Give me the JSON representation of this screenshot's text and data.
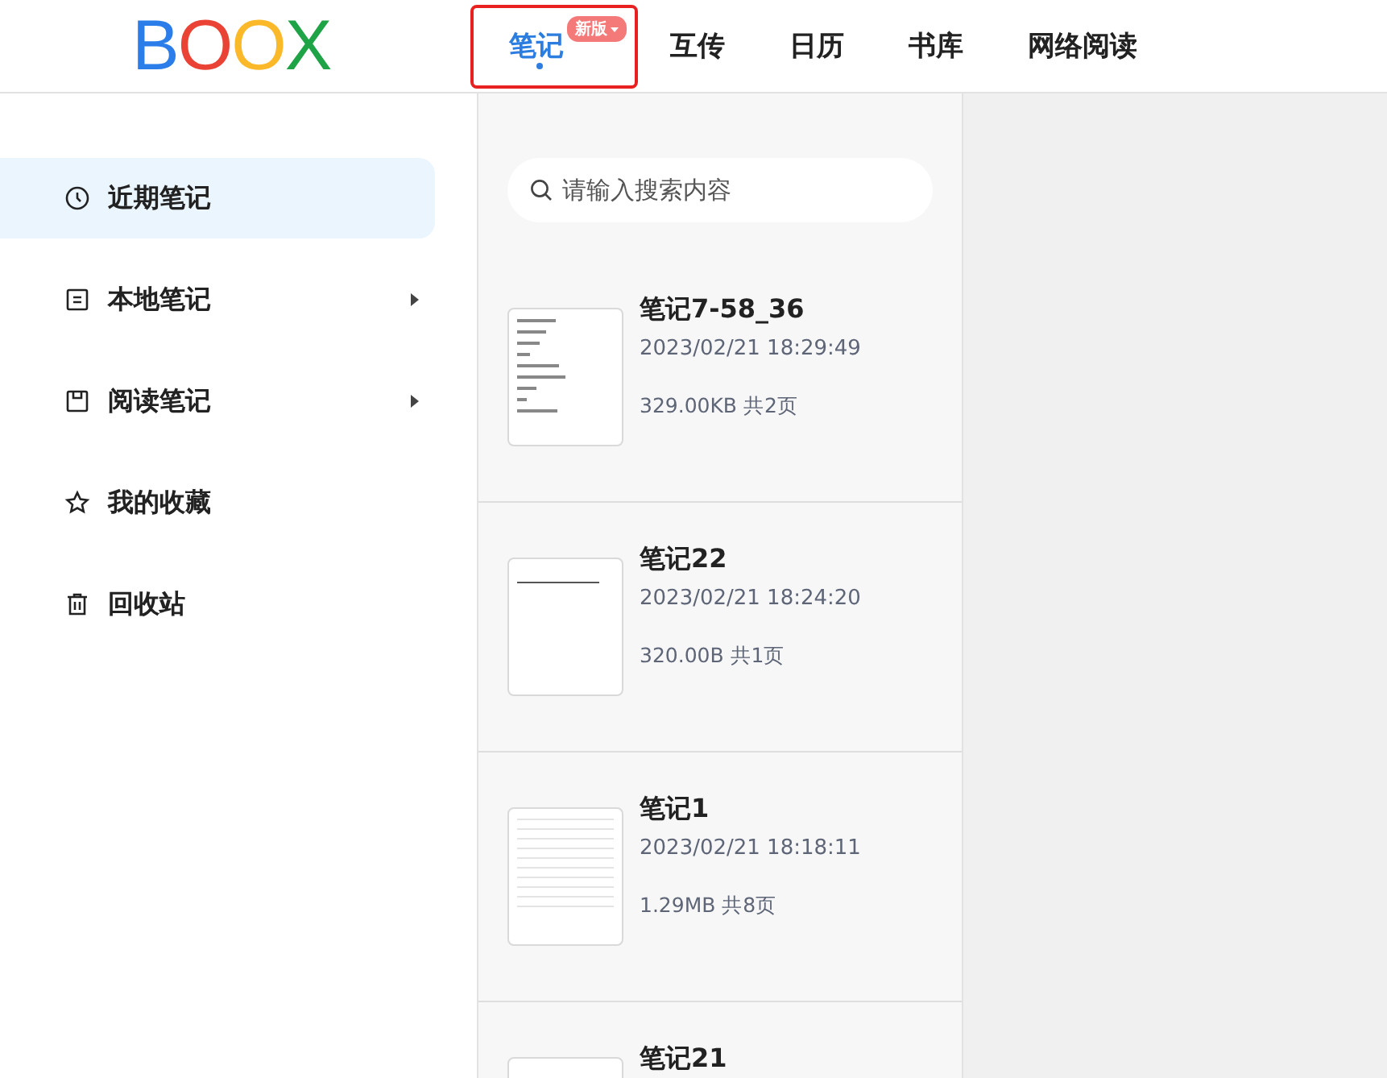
{
  "logo": {
    "letters": [
      "B",
      "O",
      "O",
      "X"
    ]
  },
  "tabs": [
    {
      "label": "笔记",
      "selected": true,
      "badge": "新版"
    },
    {
      "label": "互传",
      "selected": false
    },
    {
      "label": "日历",
      "selected": false
    },
    {
      "label": "书库",
      "selected": false
    },
    {
      "label": "网络阅读",
      "selected": false
    }
  ],
  "sidebar": {
    "items": [
      {
        "label": "近期笔记",
        "kind": "clock",
        "selected": true,
        "expandable": false
      },
      {
        "label": "本地笔记",
        "kind": "doc",
        "selected": false,
        "expandable": true
      },
      {
        "label": "阅读笔记",
        "kind": "book",
        "selected": false,
        "expandable": true
      },
      {
        "label": "我的收藏",
        "kind": "star",
        "selected": false,
        "expandable": false
      },
      {
        "label": "回收站",
        "kind": "trash",
        "selected": false,
        "expandable": false
      }
    ]
  },
  "search": {
    "placeholder": "请输入搜索内容"
  },
  "notes": [
    {
      "title": "笔记7-58_36",
      "date": "2023/02/21 18:29:49",
      "info": "329.00KB 共2页",
      "kind": "handwriting"
    },
    {
      "title": "笔记22",
      "date": "2023/02/21 18:24:20",
      "info": "320.00B 共1页",
      "kind": "text"
    },
    {
      "title": "笔记1",
      "date": "2023/02/21 18:18:11",
      "info": "1.29MB 共8页",
      "kind": "lined"
    },
    {
      "title": "笔记21",
      "kind": "blank"
    }
  ]
}
